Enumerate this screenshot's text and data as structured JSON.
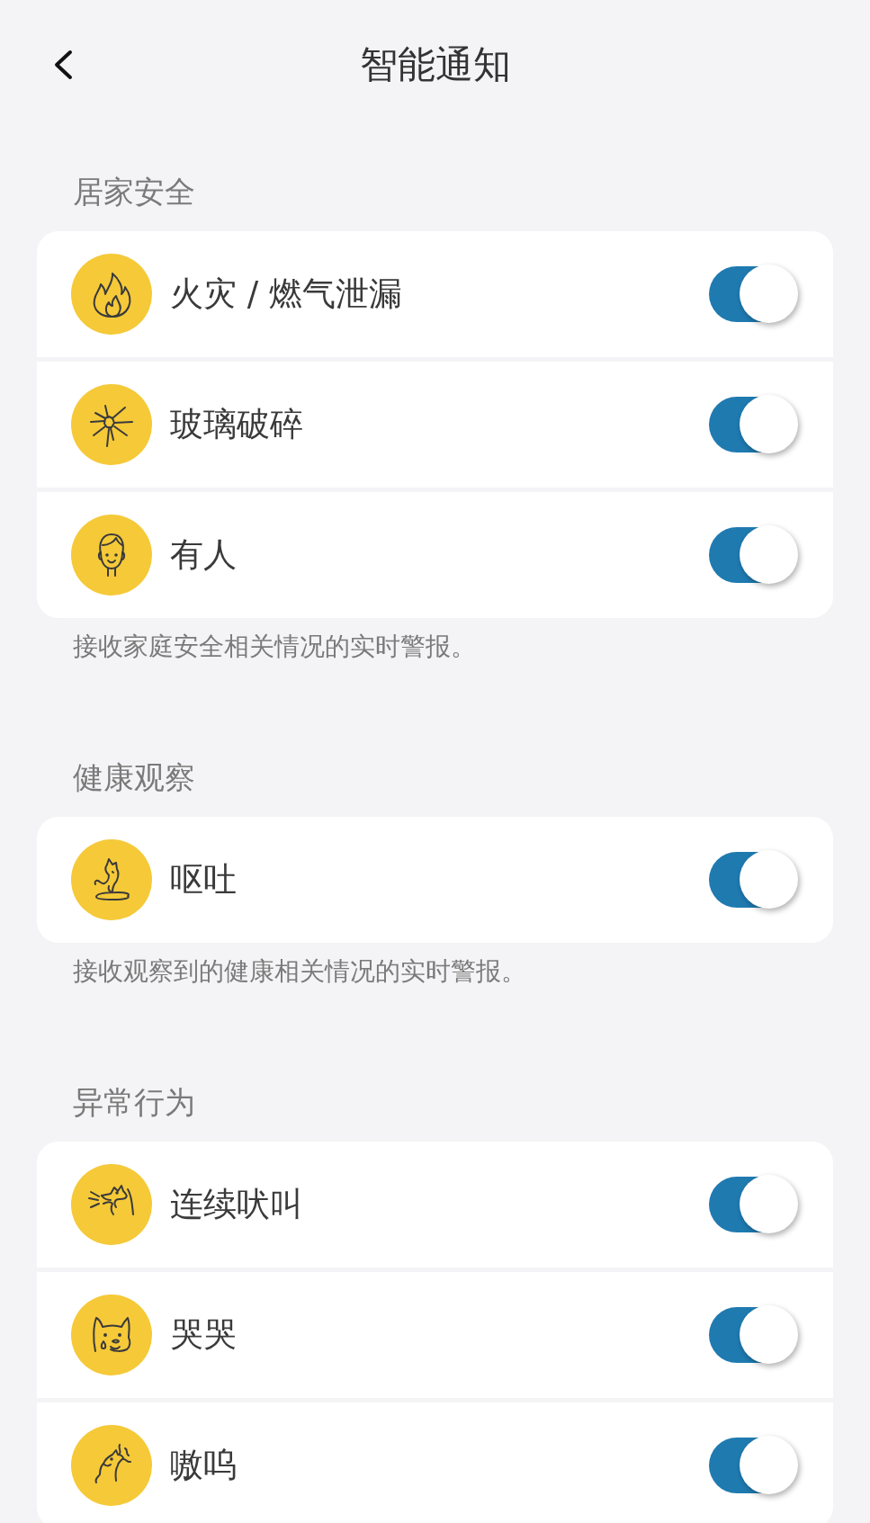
{
  "nav": {
    "title": "智能通知"
  },
  "sections": [
    {
      "title": "居家安全",
      "items": [
        {
          "label": "火灾 / 燃气泄漏",
          "on": true
        },
        {
          "label": "玻璃破碎",
          "on": true
        },
        {
          "label": "有人",
          "on": true
        }
      ],
      "note": "接收家庭安全相关情况的实时警报。"
    },
    {
      "title": "健康观察",
      "items": [
        {
          "label": "呕吐",
          "on": true
        }
      ],
      "note": "接收观察到的健康相关情况的实时警报。"
    },
    {
      "title": "异常行为",
      "items": [
        {
          "label": "连续吠叫",
          "on": true
        },
        {
          "label": "哭哭",
          "on": true
        },
        {
          "label": "嗷呜",
          "on": true
        }
      ]
    }
  ]
}
